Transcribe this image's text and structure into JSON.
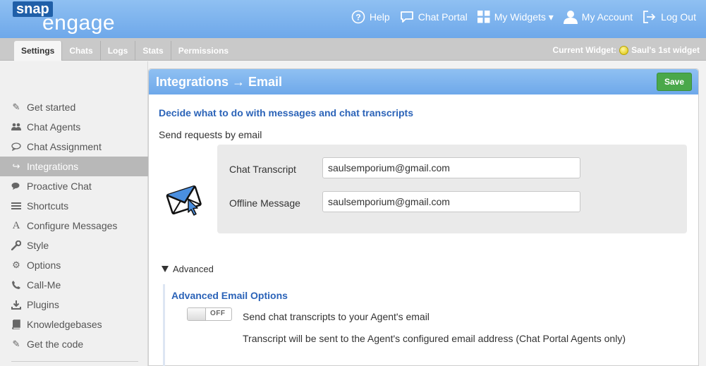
{
  "header": {
    "logo_snap": "snap",
    "logo_engage": "engage",
    "nav": [
      {
        "label": "Help",
        "icon": "help-circle-icon"
      },
      {
        "label": "Chat Portal",
        "icon": "chat-bubble-icon"
      },
      {
        "label": "My Widgets ▾",
        "icon": "grid-icon"
      },
      {
        "label": "My Account",
        "icon": "user-icon"
      },
      {
        "label": "Log Out",
        "icon": "logout-icon"
      }
    ]
  },
  "tabs": [
    "Settings",
    "Chats",
    "Logs",
    "Stats",
    "Permissions"
  ],
  "current_widget": {
    "label": "Current Widget:",
    "name": "Saul's 1st widget"
  },
  "sidebar": {
    "items": [
      {
        "label": "Get started",
        "icon": "edit-icon"
      },
      {
        "label": "Chat Agents",
        "icon": "users-icon"
      },
      {
        "label": "Chat Assignment",
        "icon": "speech-bubble-icon"
      },
      {
        "label": "Integrations",
        "icon": "share-arrow-icon",
        "active": true
      },
      {
        "label": "Proactive Chat",
        "icon": "chat-bubbles-icon"
      },
      {
        "label": "Shortcuts",
        "icon": "list-icon"
      },
      {
        "label": "Configure Messages",
        "icon": "font-icon"
      },
      {
        "label": "Style",
        "icon": "wrench-icon"
      },
      {
        "label": "Options",
        "icon": "gear-icon"
      },
      {
        "label": "Call-Me",
        "icon": "phone-icon"
      },
      {
        "label": "Plugins",
        "icon": "download-icon"
      },
      {
        "label": "Knowledgebases",
        "icon": "book-icon"
      },
      {
        "label": "Get the code",
        "icon": "edit-icon"
      }
    ]
  },
  "panel": {
    "title": "Integrations → Email",
    "save_label": "Save",
    "subtitle": "Decide what to do with messages and chat transcripts",
    "send_label": "Send requests by email",
    "chat_transcript_label": "Chat Transcript",
    "chat_transcript_value": "saulsemporium@gmail.com",
    "offline_message_label": "Offline Message",
    "offline_message_value": "saulsemporium@gmail.com",
    "advanced_label": "Advanced",
    "advanced_title": "Advanced Email Options",
    "toggle_state": "OFF",
    "toggle_description": "Send chat transcripts to your Agent's email",
    "toggle_note": "Transcript will be sent to the Agent's configured email address (Chat Portal Agents only)"
  },
  "colors": {
    "header_blue": "#7db3ee",
    "link_blue": "#2b63b8",
    "save_green": "#4aa84a"
  }
}
